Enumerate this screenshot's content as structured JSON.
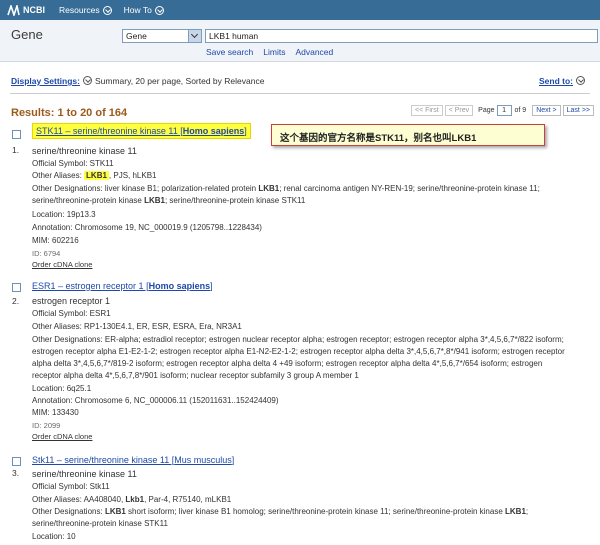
{
  "topbar": {
    "logo": "NCBI",
    "menus": [
      {
        "label": "Resources"
      },
      {
        "label": "How To"
      }
    ]
  },
  "search": {
    "db_title": "Gene",
    "db_selected": "Gene",
    "query": "LKB1 human",
    "links": [
      "Save search",
      "Limits",
      "Advanced"
    ]
  },
  "display": {
    "label": "Display Settings:",
    "summary": "Summary, 20 per page, Sorted by Relevance",
    "send_to": "Send to:"
  },
  "results_header": {
    "count": "Results: 1 to 20 of 164",
    "first": "<< First",
    "prev": "< Prev",
    "page_word": "Page",
    "page_value": "1",
    "of": "of 9",
    "next": "Next >",
    "last": "Last >>"
  },
  "callout": {
    "text": "这个基因的官方名称是STK11，别名也叫LKB1"
  },
  "results": [
    {
      "num": "1.",
      "title": "STK11 – serine/threonine kinase 11 [",
      "org": "Homo sapiens",
      "title_end": "]",
      "desc": "serine/threonine kinase 11",
      "symbol": "Official Symbol: STK11",
      "aliases_prefix": "Other Aliases: ",
      "aliases_hl": "LKB1",
      "aliases_rest": ", PJS, hLKB1",
      "designations_a": "Other Designations: liver kinase B1; polarization-related protein ",
      "designations_b": "LKB1",
      "designations_c": "; renal carcinoma antigen NY-REN-19; serine/threonine-protein kinase 11;",
      "designations_d": "serine/threonine-protein kinase ",
      "designations_e": "LKB1",
      "designations_f": "; serine/threonine-protein kinase STK11",
      "location": "Location: 19p13.3",
      "annotation": "Annotation: Chromosome 19, NC_000019.9 (1205798..1228434)",
      "mim": "MIM: 602216",
      "id": "ID: 6794",
      "order": "Order cDNA clone"
    },
    {
      "num": "2.",
      "title": "ESR1 – estrogen receptor 1 [",
      "org": "Homo sapiens",
      "title_end": "]",
      "desc": "estrogen receptor 1",
      "symbol": "Official Symbol: ESR1",
      "aliases": "Other Aliases: RP1-130E4.1, ER, ESR, ESRA, Era, NR3A1",
      "designations": [
        "Other Designations: ER-alpha; estradiol receptor; estrogen nuclear receptor alpha; estrogen receptor; estrogen receptor alpha 3*,4,5,6,7*/822 isoform;",
        "estrogen receptor alpha E1-E2-1-2; estrogen receptor alpha E1-N2-E2-1-2; estrogen receptor alpha delta 3*,4,5,6,7*,8*/941 isoform; estrogen receptor",
        "alpha delta 3*,4,5,6,7*/819-2 isoform; estrogen receptor alpha delta 4 +49 isoform; estrogen receptor alpha delta 4*,5,6,7*/654 isoform; estrogen",
        "receptor alpha delta 4*,5,6,7,8*/901 isoform; nuclear receptor subfamily 3 group A member 1"
      ],
      "location": "Location: 6q25.1",
      "annotation": "Annotation: Chromosome 6, NC_000006.11 (152011631..152424409)",
      "mim": "MIM: 133430",
      "id": "ID: 2099",
      "order": "Order cDNA clone"
    },
    {
      "num": "3.",
      "title": "Stk11 – serine/threonine kinase 11 [",
      "org": "Mus musculus",
      "title_end": "]",
      "desc": "serine/threonine kinase 11",
      "symbol": "Official Symbol: Stk11",
      "aliases_prefix": "Other Aliases: AA408040, ",
      "aliases_bold": "Lkb1",
      "aliases_rest": ", Par-4, R75140, mLKB1",
      "designations_prefix": "Other Designations: ",
      "designations_b": "LKB1",
      "designations_c": " short isoform; liver kinase B1 homolog; serine/threonine-protein kinase 11; serine/threonine-protein kinase ",
      "designations_d": "LKB1",
      "designations_e": ";",
      "designations_f": "serine/threonine-protein kinase STK11",
      "location": "Location: 10"
    }
  ]
}
